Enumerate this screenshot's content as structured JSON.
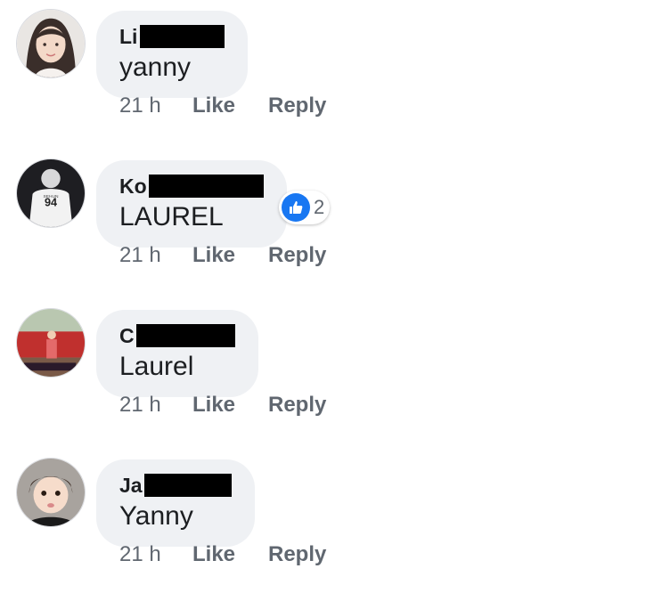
{
  "colors": {
    "bubble": "#eff1f4",
    "meta_text": "#606770",
    "like_blue": "#1877f2",
    "redaction": "#000000"
  },
  "comments": [
    {
      "name_visible": "Li",
      "text": "yanny",
      "time": "21 h",
      "like_label": "Like",
      "reply_label": "Reply"
    },
    {
      "name_visible": "Ko",
      "text": "LAUREL",
      "time": "21 h",
      "like_label": "Like",
      "reply_label": "Reply",
      "reaction_icon": "thumbs-up-icon",
      "reaction_count": "2"
    },
    {
      "name_visible": "C",
      "text": "Laurel",
      "time": "21 h",
      "like_label": "Like",
      "reply_label": "Reply"
    },
    {
      "name_visible": "Ja",
      "text": "Yanny",
      "time": "21 h",
      "like_label": "Like",
      "reply_label": "Reply"
    }
  ]
}
